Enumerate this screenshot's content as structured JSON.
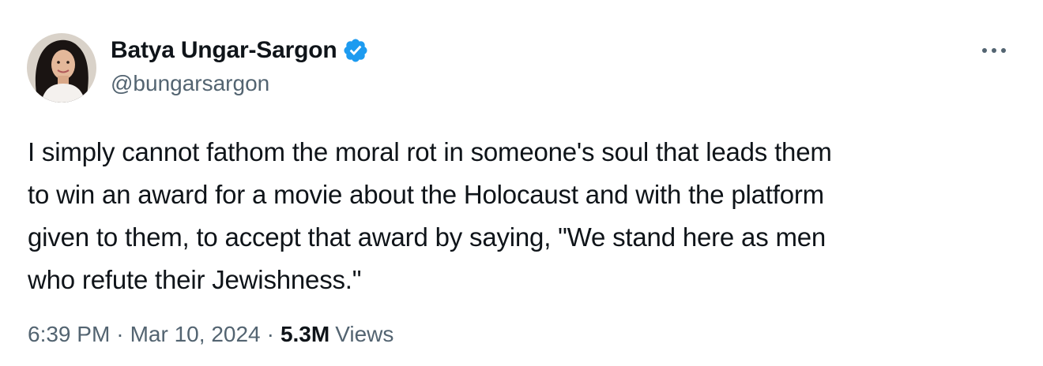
{
  "author": {
    "display_name": "Batya Ungar-Sargon",
    "handle": "@bungarsargon",
    "verified": true,
    "verified_badge_color": "#1d9bf0"
  },
  "tweet": {
    "text": "I simply cannot fathom the moral rot in someone's soul that leads them\nto win an award for a movie about the Holocaust and with the platform\ngiven to them, to accept that award by saying, \"We stand here as men\nwho refute their Jewishness.\""
  },
  "meta": {
    "time": "6:39 PM",
    "separator": "·",
    "date": "Mar 10, 2024",
    "views_count": "5.3M",
    "views_label": "Views"
  },
  "icons": {
    "more": "more-horizontal-icon",
    "verified": "verified-badge-icon"
  },
  "colors": {
    "text_primary": "#0f1419",
    "text_secondary": "#536471",
    "accent": "#1d9bf0"
  }
}
